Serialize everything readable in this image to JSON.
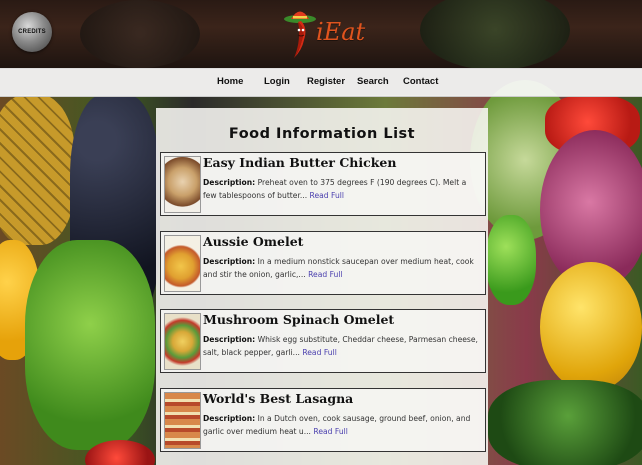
{
  "header": {
    "credits_label": "CREDITS",
    "logo_text": "iEat"
  },
  "nav": {
    "items": [
      "Home",
      "Login",
      "Register",
      "Search",
      "Contact"
    ]
  },
  "main": {
    "title": "Food Information List",
    "description_label": "Description:",
    "read_full_label": "Read Full",
    "foods": [
      {
        "name": "Easy Indian Butter Chicken",
        "description": "Preheat oven to 375 degrees F (190 degrees C). Melt a few tablespoons of butter..."
      },
      {
        "name": "Aussie Omelet",
        "description": "In a medium nonstick saucepan over medium heat, cook and stir the onion, garlic,..."
      },
      {
        "name": "Mushroom Spinach Omelet",
        "description": "Whisk egg substitute, Cheddar cheese, Parmesan cheese, salt, black pepper, garli..."
      },
      {
        "name": "World's Best Lasagna",
        "description": "In a Dutch oven, cook sausage, ground beef, onion, and garlic over medium heat u..."
      }
    ]
  },
  "colors": {
    "logo": "#e0541e",
    "link": "#4a3fae"
  }
}
